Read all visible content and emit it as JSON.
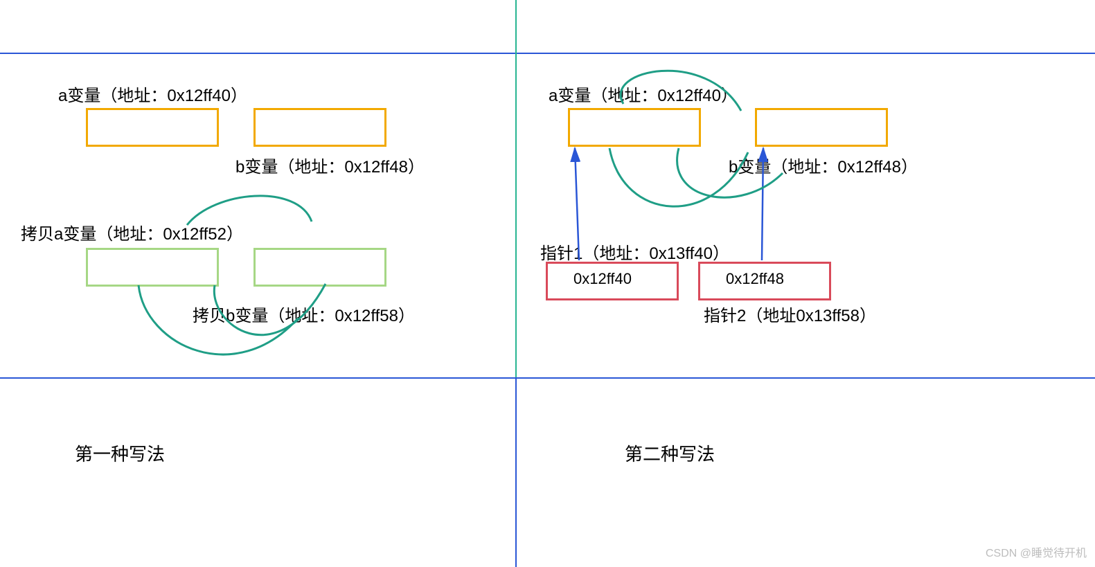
{
  "left": {
    "varA": "a变量（地址：0x12ff40）",
    "varB": "b变量（地址：0x12ff48）",
    "copyA": "拷贝a变量（地址：0x12ff52）",
    "copyB": "拷贝b变量（地址：0x12ff58）",
    "caption": "第一种写法"
  },
  "right": {
    "varA": "a变量（地址：0x12ff40）",
    "varB": "b变量（地址：0x12ff48）",
    "ptr1": "指针1（地址：0x13ff40）",
    "ptr2": "指针2（地址0x13ff58）",
    "ptr1Value": "0x12ff40",
    "ptr2Value": "0x12ff48",
    "caption": "第二种写法"
  },
  "watermark": "CSDN @睡觉待开机",
  "colors": {
    "blueLine": "#2a56d6",
    "greenLine": "#27b591",
    "orange": "#f2a900",
    "lightGreen": "#a6d785",
    "red": "#d94a5a"
  }
}
